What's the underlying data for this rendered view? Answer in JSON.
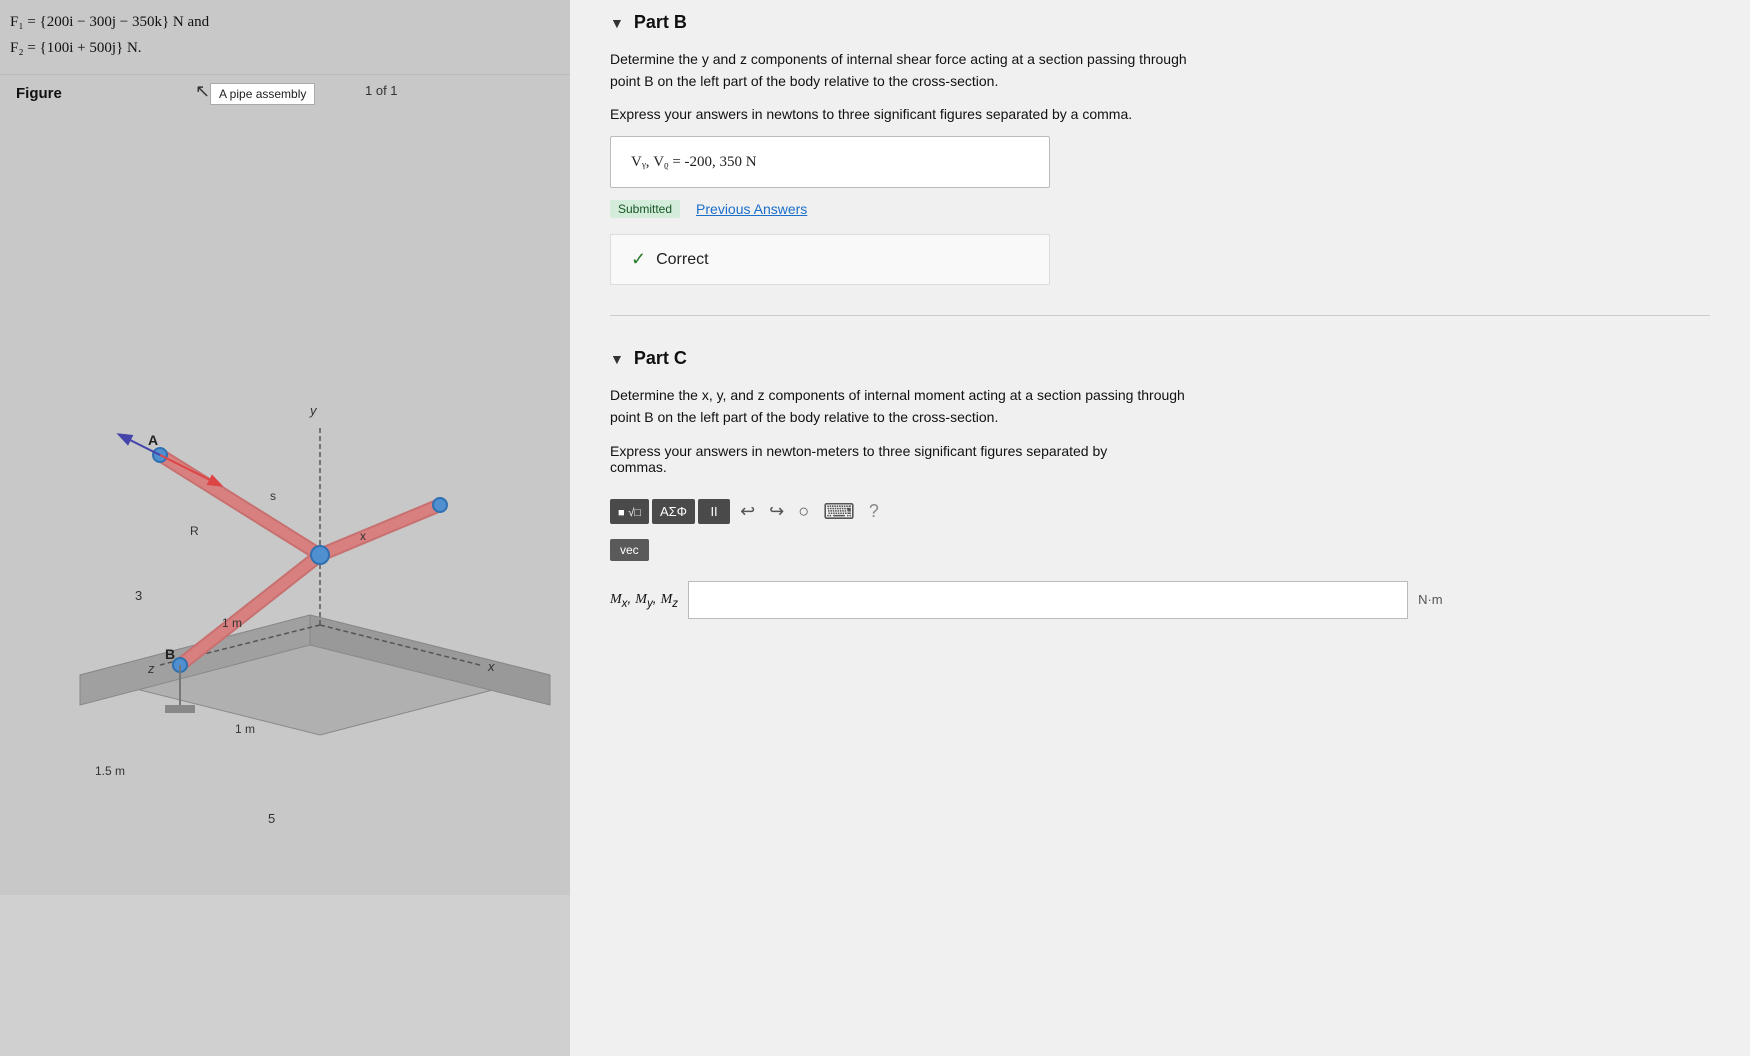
{
  "left_panel": {
    "forces": {
      "line1": "F₁ = {200i − 300j − 350k} N and",
      "line2": "F₂ = {100i + 500j} N."
    },
    "figure_label": "Figure",
    "tooltip": "A pipe assembly",
    "of_label": "1 of 1"
  },
  "right_panel": {
    "part_b": {
      "title": "Part B",
      "description_line1": "Determine the y and z components of internal shear force acting at a section passing through",
      "description_line2": "point B on the left part of the body relative to the cross-section.",
      "express_label": "Express your answers in newtons to three significant figures separated by a comma.",
      "answer_value": "Vᵧ, Vᵨ =  -200, 350  N",
      "submitted_label": "Submitted",
      "previous_answers": "Previous Answers",
      "correct_check": "✓",
      "correct_label": "Correct"
    },
    "part_c": {
      "title": "Part C",
      "description_line1": "Determine the x, y, and z components of internal moment acting at a section passing through",
      "description_line2": "point B on the left part of the body relative to the cross-section.",
      "express_label": "Express your answers in newton-meters to three significant figures separated by",
      "express_label2": "commas.",
      "toolbar": {
        "sqrt_btn": "√□",
        "sigma_btn": "AΣΦ",
        "pipe_btn": "II",
        "vec_btn": "vec"
      },
      "moment_label": "Mₓ, Mᵧ, Mᵨ",
      "input_placeholder": "",
      "unit": "N·m"
    }
  }
}
